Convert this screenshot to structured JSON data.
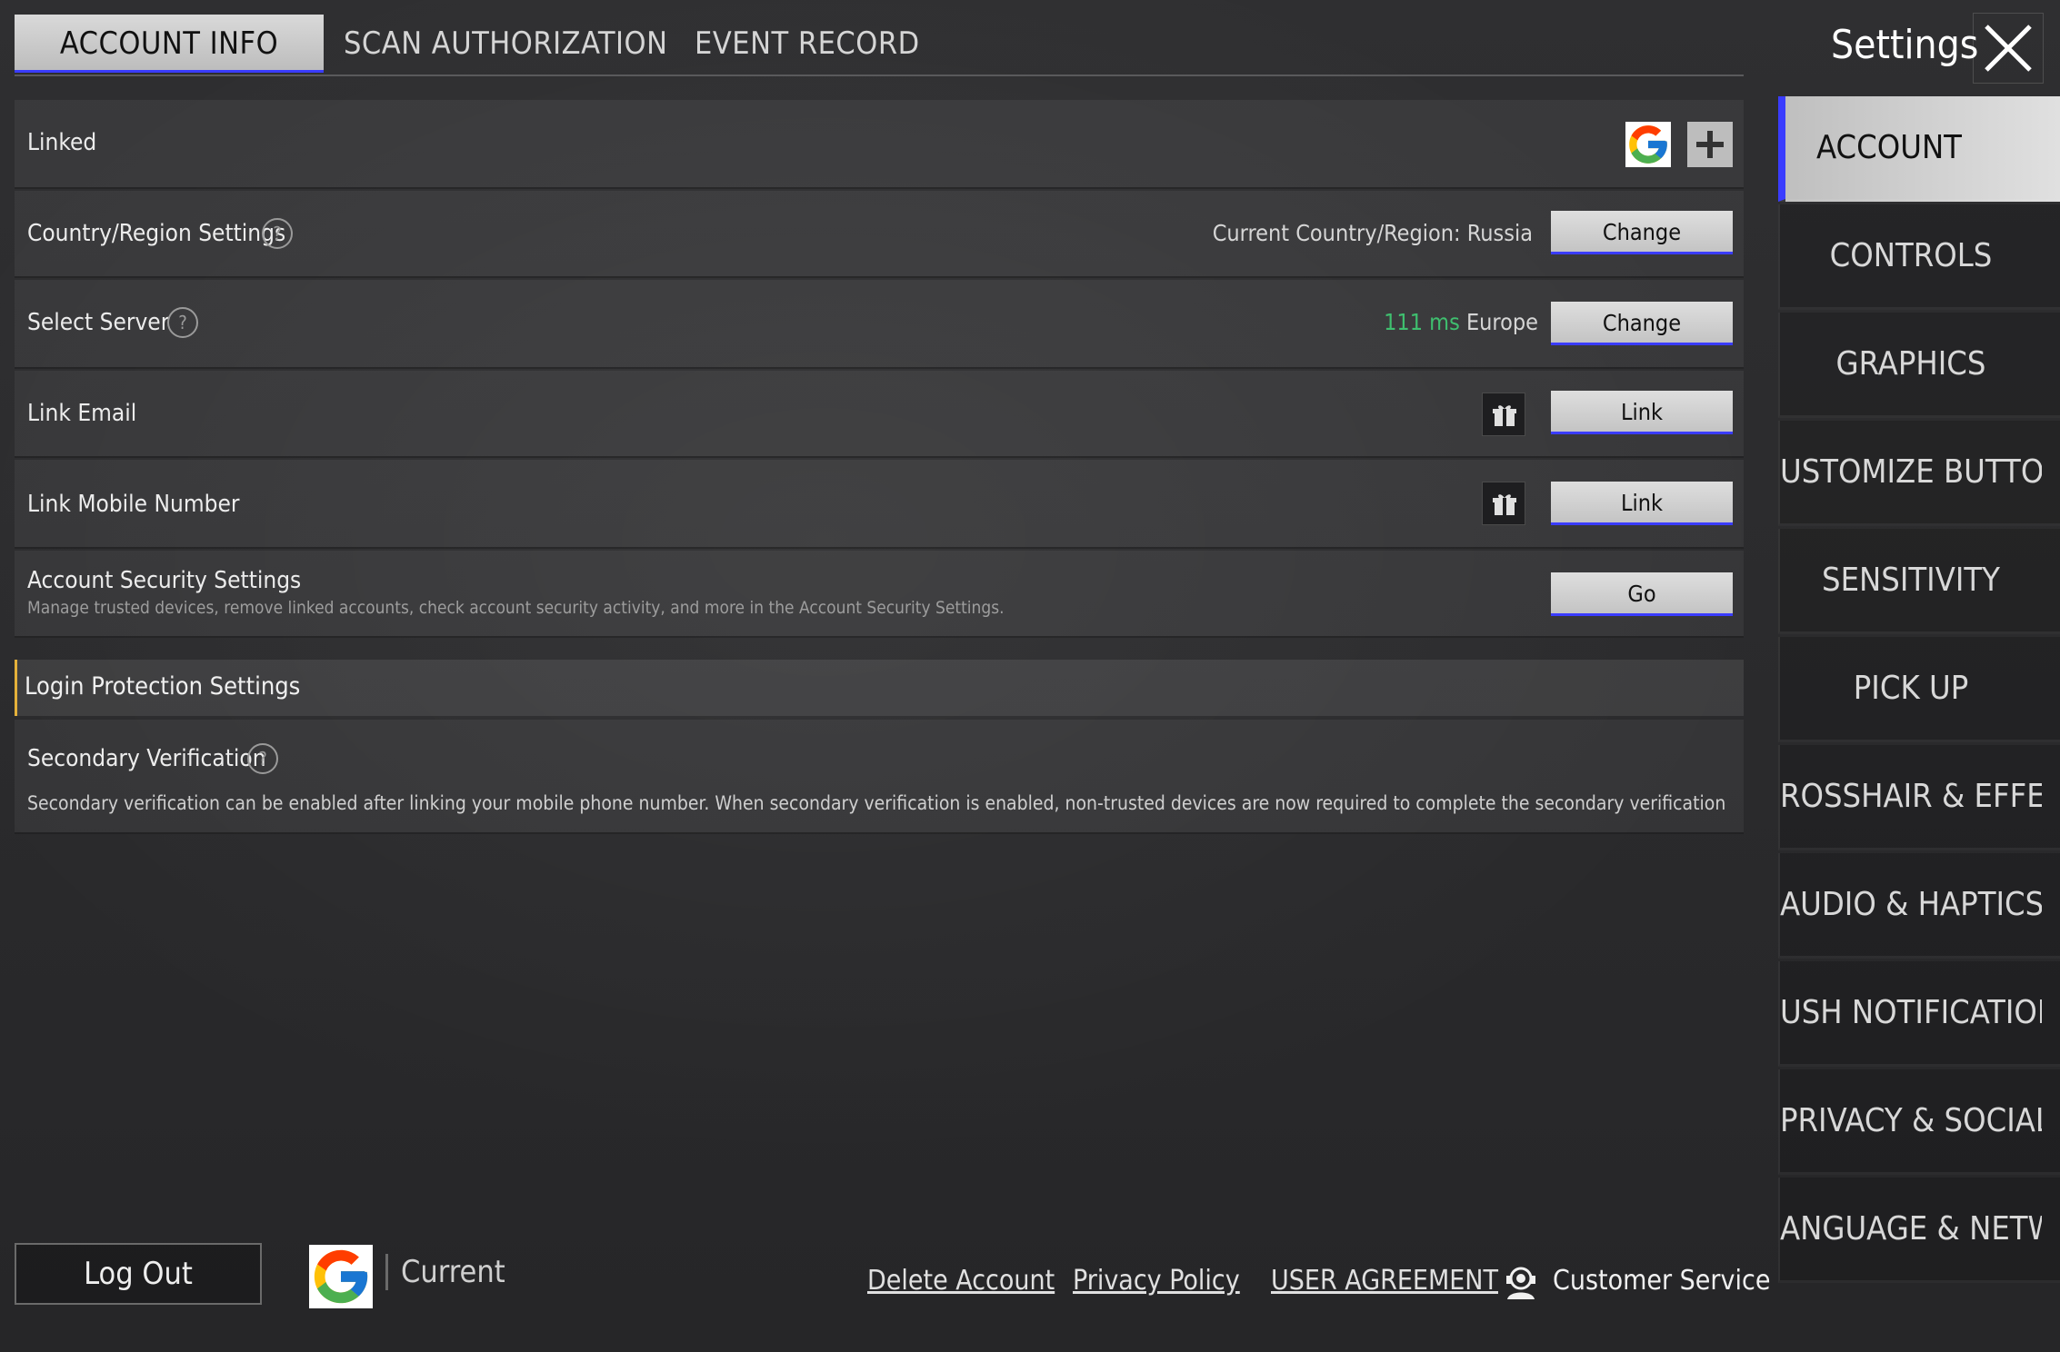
{
  "tabs": [
    {
      "label": "ACCOUNT INFO",
      "active": true
    },
    {
      "label": "SCAN AUTHORIZATION",
      "active": false
    },
    {
      "label": "EVENT RECORD",
      "active": false
    }
  ],
  "rows": {
    "linked": {
      "label": "Linked"
    },
    "country": {
      "label": "Country/Region Settings",
      "value": "Current Country/Region: Russia",
      "button": "Change"
    },
    "server": {
      "label": "Select Server",
      "ping": "111 ms",
      "region": "Europe",
      "button": "Change"
    },
    "email": {
      "label": "Link Email",
      "button": "Link"
    },
    "mobile": {
      "label": "Link Mobile Number",
      "button": "Link"
    },
    "security": {
      "label": "Account Security Settings",
      "description": "Manage trusted devices, remove linked accounts, check account security activity, and more in the Account Security Settings.",
      "button": "Go"
    }
  },
  "login_protection": {
    "header": "Login Protection Settings",
    "secondary": {
      "label": "Secondary Verification",
      "description": "Secondary verification can be enabled after linking your mobile phone number. When secondary verification is enabled, non-trusted devices are now required to complete the secondary verification to enter the game."
    }
  },
  "sidebar": {
    "title": "Settings",
    "items": [
      {
        "label": "ACCOUNT",
        "active": true
      },
      {
        "label": "CONTROLS"
      },
      {
        "label": "GRAPHICS"
      },
      {
        "label": "USTOMIZE BUTTONS"
      },
      {
        "label": "SENSITIVITY"
      },
      {
        "label": "PICK UP"
      },
      {
        "label": "ROSSHAIR & EFFEC"
      },
      {
        "label": "AUDIO & HAPTICS"
      },
      {
        "label": "USH NOTIFICATIONS"
      },
      {
        "label": "PRIVACY & SOCIAL"
      },
      {
        "label": "ANGUAGE & NETWO"
      }
    ]
  },
  "footer": {
    "logout": "Log Out",
    "current": "Current",
    "delete_account": "Delete Account",
    "privacy_policy": "Privacy Policy",
    "user_agreement": "USER AGREEMENT",
    "customer_service": "Customer Service"
  },
  "colors": {
    "accent_blue": "#3a3cff",
    "ping_green": "#3fbf6f",
    "section_marker": "#e5b13a"
  },
  "icons": {
    "help": "question-circle-icon",
    "gift": "gift-icon",
    "google": "google-logo-icon",
    "plus": "plus-icon",
    "close": "close-icon",
    "headset": "customer-service-icon"
  }
}
